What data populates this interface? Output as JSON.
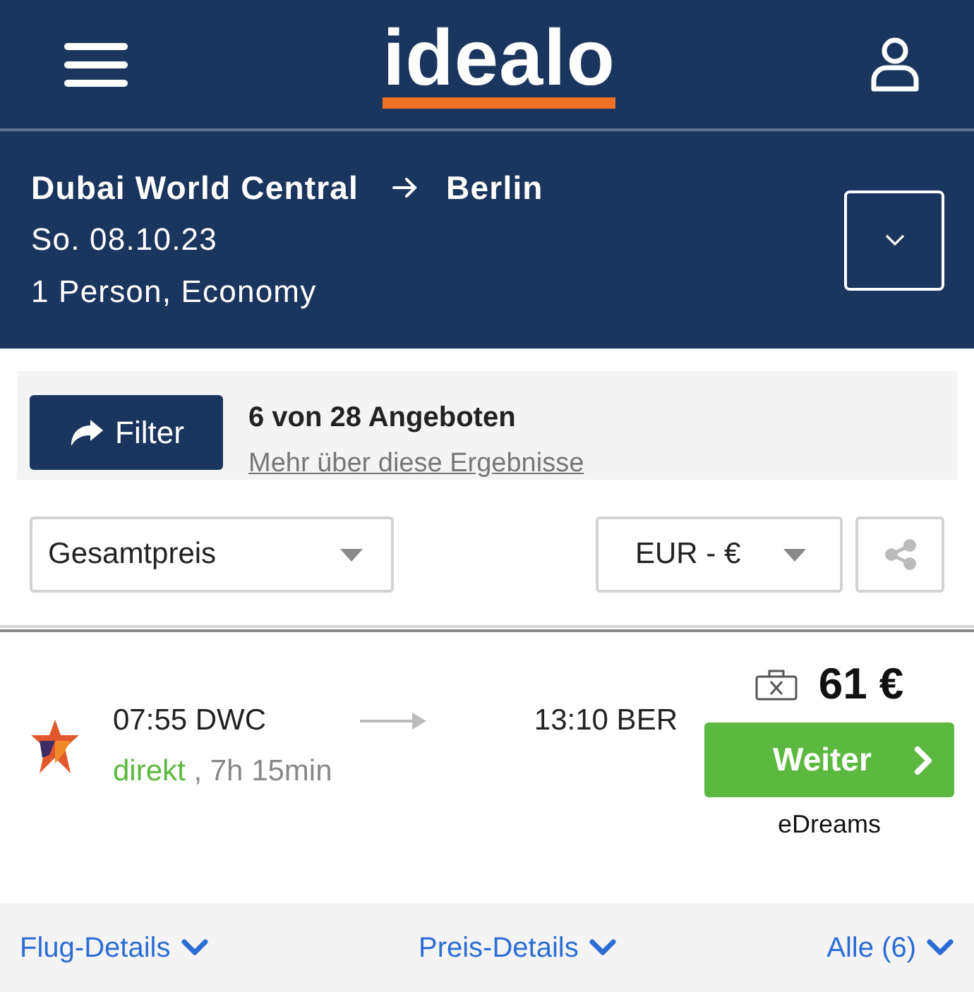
{
  "header": {
    "logo": "idealo"
  },
  "search_summary": {
    "origin": "Dubai World Central",
    "destination": "Berlin",
    "date": "So. 08.10.23",
    "passengers": "1 Person, Economy",
    "expanded": false
  },
  "results_bar": {
    "filter_button": "Filter",
    "count": "6 von 28 Angeboten",
    "info_link": "Mehr über diese Ergebnisse"
  },
  "sort_dropdown": {
    "value": "Gesamtpreis"
  },
  "currency_dropdown": {
    "value": "EUR - €"
  },
  "offers": [
    {
      "departure": "07:55 DWC",
      "arrival": "13:10 BER",
      "stops": "direkt",
      "direct": true,
      "duration": ", 7h 15min",
      "baggage_included": false,
      "price": "61 €",
      "button": "Weiter",
      "provider": "eDreams"
    }
  ],
  "detail_links": [
    {
      "label": "Flug-Details",
      "expanded": false
    },
    {
      "label": "Preis-Details",
      "expanded": false
    },
    {
      "label": "Alle (6)",
      "expanded": false
    }
  ]
}
